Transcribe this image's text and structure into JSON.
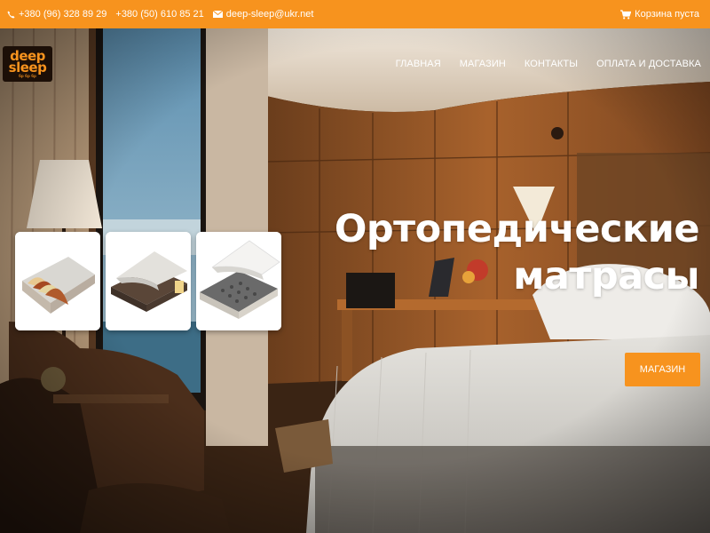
{
  "topbar": {
    "phone_1": "+380 (96) 328 89 29",
    "phone_2": "+380 (50) 610 85 21",
    "email": "deep-sleep@ukr.net",
    "cart": "Корзина пуста"
  },
  "logo": {
    "line_1": "deep",
    "line_2": "sleep",
    "tagline": "бр бр бр"
  },
  "nav": [
    "ГЛАВНАЯ",
    "МАГАЗИН",
    "КОНТАКТЫ",
    "ОПЛАТА И ДОСТАВКА"
  ],
  "hero": {
    "title_line_1": "Ортопедические",
    "title_line_2": "матрасы",
    "button": "МАГАЗИН"
  },
  "cards": [
    {
      "name": "mattress-layers"
    },
    {
      "name": "mattress-cover"
    },
    {
      "name": "mattress-springs"
    }
  ],
  "colors": {
    "accent": "#f7931e",
    "logo_bg": "#1c0f07"
  },
  "icons": {
    "phone": "phone-icon",
    "email": "envelope-icon",
    "cart": "cart-icon"
  }
}
